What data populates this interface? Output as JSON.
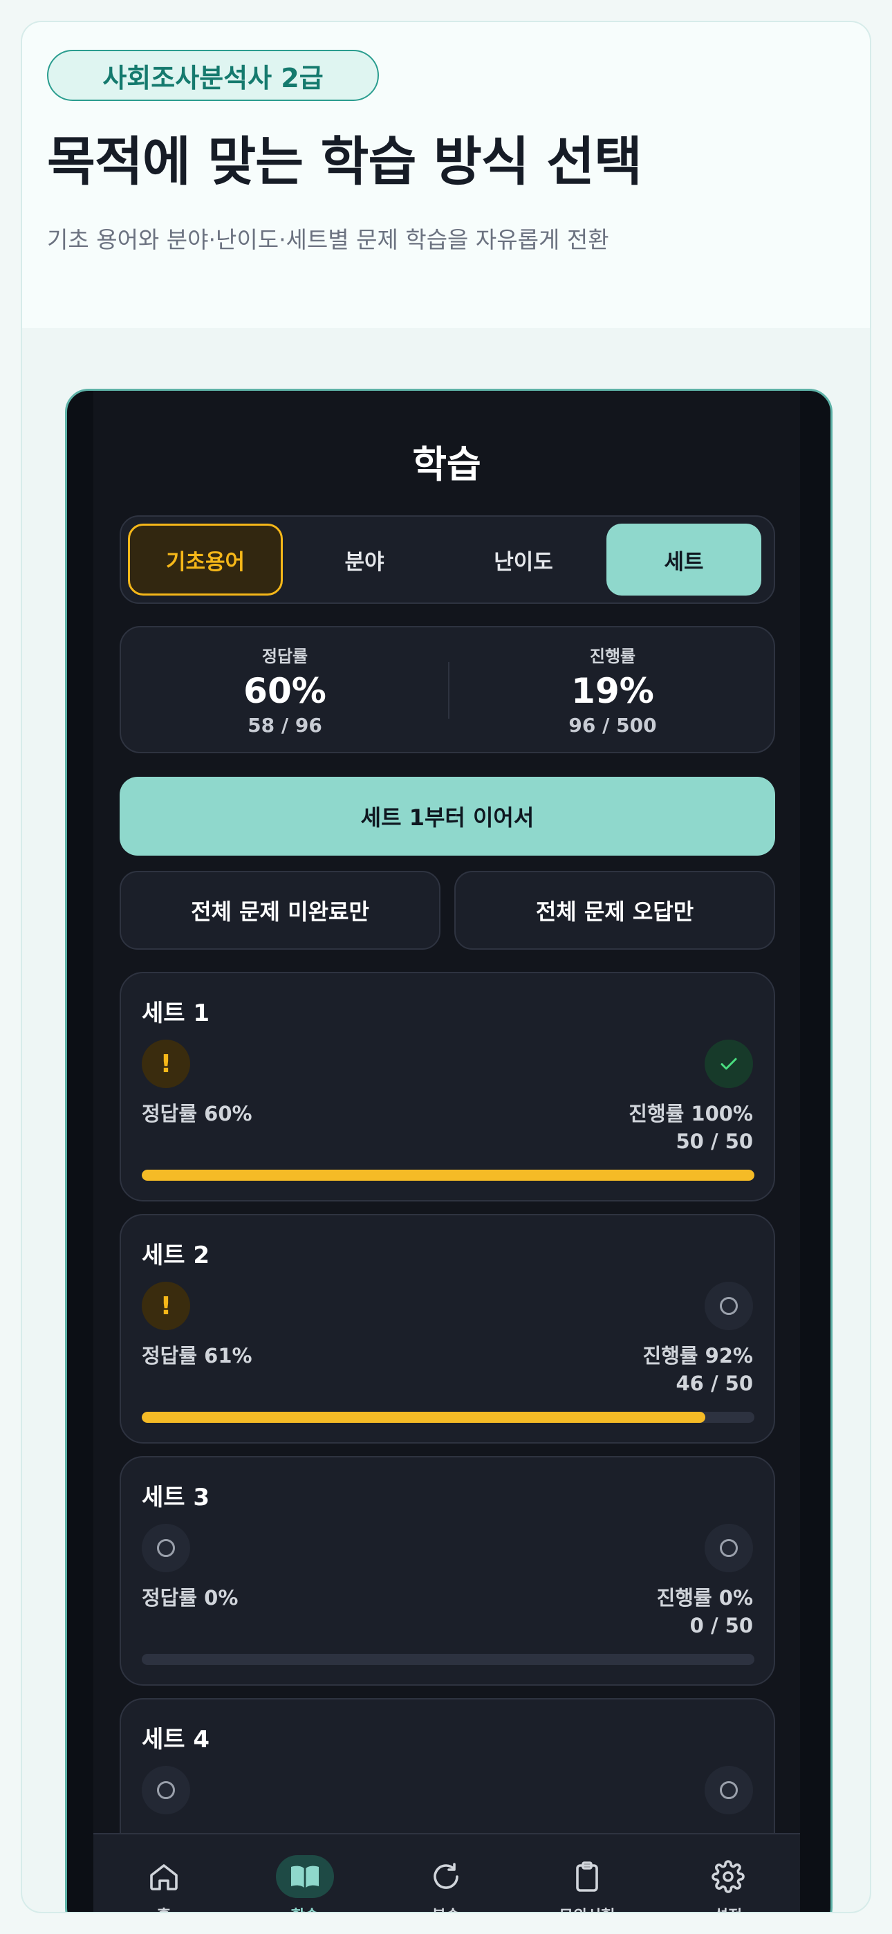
{
  "hero": {
    "badge": "사회조사분석사 2급",
    "title": "목적에 맞는 학습 방식 선택",
    "subtitle": "기초 용어와 분야·난이도·세트별 문제 학습을 자유롭게 전환"
  },
  "app": {
    "title": "학습",
    "segments": [
      {
        "label": "기초용어",
        "state": "highlighted"
      },
      {
        "label": "분야",
        "state": "normal"
      },
      {
        "label": "난이도",
        "state": "normal"
      },
      {
        "label": "세트",
        "state": "selected"
      }
    ],
    "stats": {
      "accuracy": {
        "label": "정답률",
        "value": "60%",
        "detail": "58 / 96"
      },
      "progress": {
        "label": "진행률",
        "value": "19%",
        "detail": "96 / 500"
      }
    },
    "continue_button": "세트 1부터 이어서",
    "incomplete_button": "전체 문제 미완료만",
    "wrong_button": "전체 문제 오답만",
    "sets": [
      {
        "title": "세트 1",
        "left_icon": "warning-icon",
        "right_icon": "check-icon",
        "accuracy": "정답률 60%",
        "progress": "진행률 100%",
        "count": "50 / 50",
        "fill": 1.0
      },
      {
        "title": "세트 2",
        "left_icon": "warning-icon",
        "right_icon": "empty-circle-icon",
        "accuracy": "정답률 61%",
        "progress": "진행률 92%",
        "count": "46 / 50",
        "fill": 0.92
      },
      {
        "title": "세트 3",
        "left_icon": "empty-circle-icon",
        "right_icon": "empty-circle-icon",
        "accuracy": "정답률 0%",
        "progress": "진행률 0%",
        "count": "0 / 50",
        "fill": 0.0
      },
      {
        "title": "세트 4",
        "left_icon": "empty-circle-icon",
        "right_icon": "empty-circle-icon"
      }
    ],
    "tabbar": [
      {
        "label": "홈",
        "icon": "home-icon"
      },
      {
        "label": "학습",
        "icon": "book-icon",
        "active": true
      },
      {
        "label": "복습",
        "icon": "refresh-icon"
      },
      {
        "label": "모의시험",
        "icon": "clipboard-icon"
      },
      {
        "label": "설정",
        "icon": "gear-icon"
      }
    ]
  },
  "colors": {
    "accent_mint": "#8fd8cc",
    "accent_gold": "#f5b719",
    "success_green": "#4ade80",
    "background_dark": "#12151c"
  }
}
